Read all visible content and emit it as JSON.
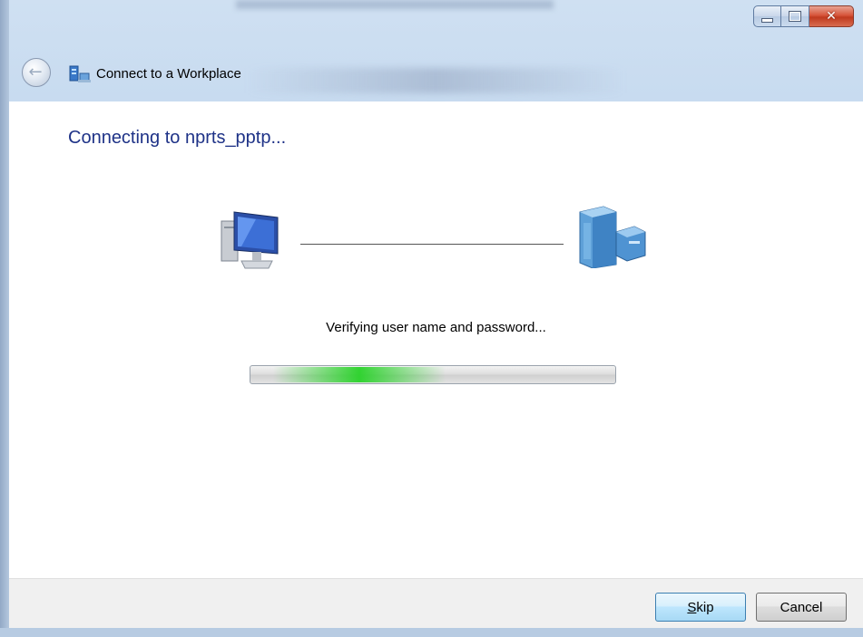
{
  "window": {
    "title": "Connect to a Workplace"
  },
  "content": {
    "heading": "Connecting to nprts_pptp...",
    "status": "Verifying user name and password..."
  },
  "footer": {
    "skip_label_access_key": "S",
    "skip_label_rest": "kip",
    "cancel_label": "Cancel"
  },
  "icons": {
    "back": "back-arrow-icon",
    "title": "network-connection-icon",
    "client": "computer-icon",
    "server": "server-icon"
  },
  "colors": {
    "heading": "#1e3287",
    "progress_glow": "#28d228"
  }
}
